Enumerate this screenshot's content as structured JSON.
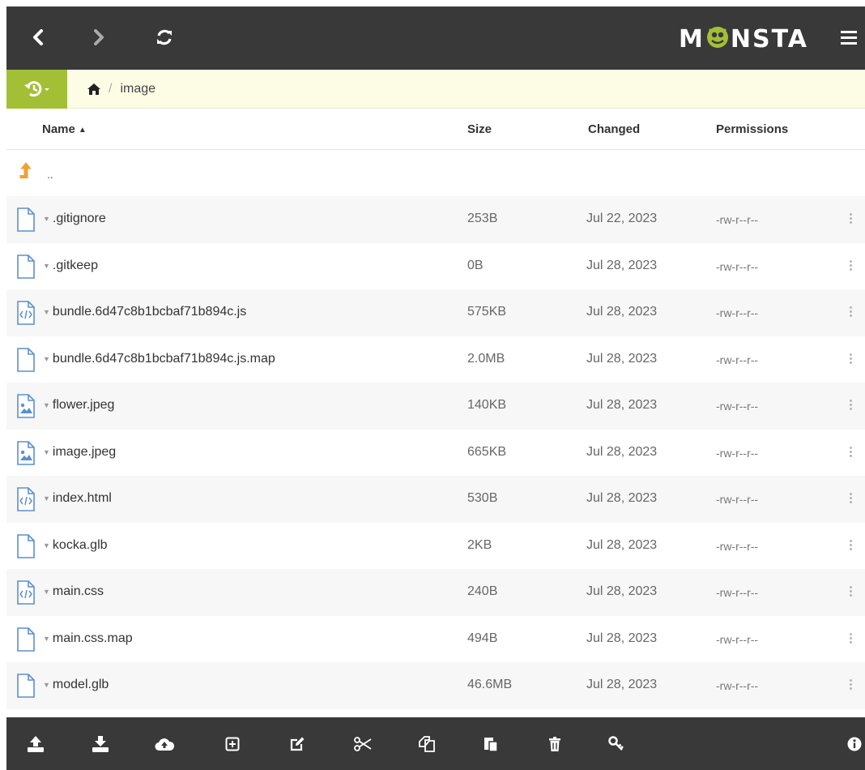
{
  "app": {
    "logo_text_left": "M",
    "logo_text_right": "NSTA"
  },
  "breadcrumb": {
    "home_label": "home",
    "current": "image"
  },
  "columns": {
    "name": "Name",
    "size": "Size",
    "changed": "Changed",
    "permissions": "Permissions"
  },
  "parent_row": {
    "label": ".."
  },
  "files": [
    {
      "name": ".gitignore",
      "size": "253B",
      "changed": "Jul 22, 2023",
      "perm": "-rw-r--r--",
      "icon": "file-icon"
    },
    {
      "name": ".gitkeep",
      "size": "0B",
      "changed": "Jul 28, 2023",
      "perm": "-rw-r--r--",
      "icon": "file-icon"
    },
    {
      "name": "bundle.6d47c8b1bcbaf71b894c.js",
      "size": "575KB",
      "changed": "Jul 28, 2023",
      "perm": "-rw-r--r--",
      "icon": "code-file-icon"
    },
    {
      "name": "bundle.6d47c8b1bcbaf71b894c.js.map",
      "size": "2.0MB",
      "changed": "Jul 28, 2023",
      "perm": "-rw-r--r--",
      "icon": "file-icon"
    },
    {
      "name": "flower.jpeg",
      "size": "140KB",
      "changed": "Jul 28, 2023",
      "perm": "-rw-r--r--",
      "icon": "image-file-icon"
    },
    {
      "name": "image.jpeg",
      "size": "665KB",
      "changed": "Jul 28, 2023",
      "perm": "-rw-r--r--",
      "icon": "image-file-icon"
    },
    {
      "name": "index.html",
      "size": "530B",
      "changed": "Jul 28, 2023",
      "perm": "-rw-r--r--",
      "icon": "code-file-icon"
    },
    {
      "name": "kocka.glb",
      "size": "2KB",
      "changed": "Jul 28, 2023",
      "perm": "-rw-r--r--",
      "icon": "file-icon"
    },
    {
      "name": "main.css",
      "size": "240B",
      "changed": "Jul 28, 2023",
      "perm": "-rw-r--r--",
      "icon": "code-file-icon"
    },
    {
      "name": "main.css.map",
      "size": "494B",
      "changed": "Jul 28, 2023",
      "perm": "-rw-r--r--",
      "icon": "file-icon"
    },
    {
      "name": "model.glb",
      "size": "46.6MB",
      "changed": "Jul 28, 2023",
      "perm": "-rw-r--r--",
      "icon": "file-icon"
    }
  ],
  "toolbar": [
    "upload-icon",
    "download-icon",
    "cloud-upload-icon",
    "new-folder-icon",
    "edit-icon",
    "cut-icon",
    "copy-icon",
    "paste-icon",
    "delete-icon",
    "permissions-key-icon",
    "info-icon"
  ],
  "colors": {
    "topbar": "#393939",
    "accent_green": "#a3bf36",
    "crumb_bg": "#fdfde6",
    "parent_arrow": "#f0a030",
    "icon_blue": "#5b8fd1"
  }
}
